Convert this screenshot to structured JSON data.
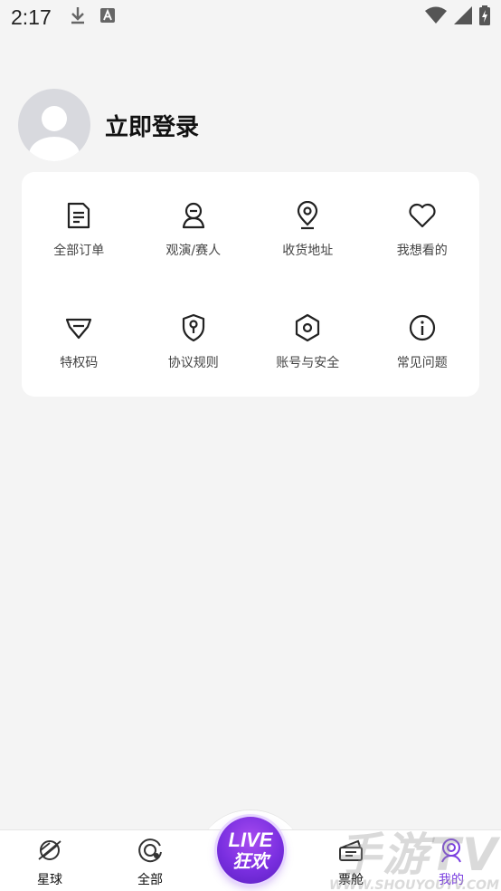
{
  "status": {
    "time": "2:17"
  },
  "profile": {
    "login_label": "立即登录"
  },
  "menu": [
    {
      "label": "全部订单",
      "icon": "order-list-icon"
    },
    {
      "label": "观演/赛人",
      "icon": "audience-person-icon"
    },
    {
      "label": "收货地址",
      "icon": "location-pin-icon"
    },
    {
      "label": "我想看的",
      "icon": "heart-icon"
    },
    {
      "label": "特权码",
      "icon": "diamond-icon"
    },
    {
      "label": "协议规则",
      "icon": "shield-key-icon"
    },
    {
      "label": "账号与安全",
      "icon": "hexagon-nut-icon"
    },
    {
      "label": "常见问题",
      "icon": "info-circle-icon"
    }
  ],
  "tabbar": {
    "tabs": [
      {
        "label": "星球",
        "icon": "planet-icon"
      },
      {
        "label": "全部",
        "icon": "all-target-icon"
      },
      {
        "label": "票舱",
        "icon": "ticket-cabin-icon"
      },
      {
        "label": "我的",
        "icon": "mine-person-icon"
      }
    ],
    "live": {
      "line1": "LIVE",
      "line2": "狂欢"
    },
    "active_color": "#7a3ee0"
  },
  "watermark": {
    "line1": "手游TV",
    "line2": "WWW.SHOUYOUTV.COM"
  }
}
